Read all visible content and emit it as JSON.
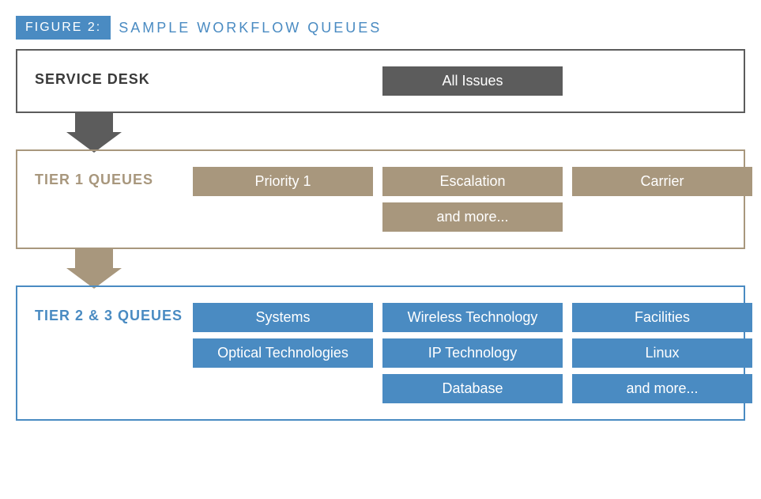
{
  "figure": {
    "badge": "FIGURE 2:",
    "title": "SAMPLE WORKFLOW QUEUES"
  },
  "serviceDesk": {
    "label": "SERVICE DESK",
    "queues": [
      "All Issues"
    ]
  },
  "tier1": {
    "label": "TIER 1 QUEUES",
    "queues": [
      "Priority 1",
      "Escalation",
      "Carrier",
      "and more..."
    ]
  },
  "tier23": {
    "label": "TIER 2 & 3 QUEUES",
    "queues": [
      "Systems",
      "Wireless Technology",
      "Facilities",
      "Optical Technologies",
      "IP Technology",
      "Linux",
      "Database",
      "and more..."
    ]
  }
}
